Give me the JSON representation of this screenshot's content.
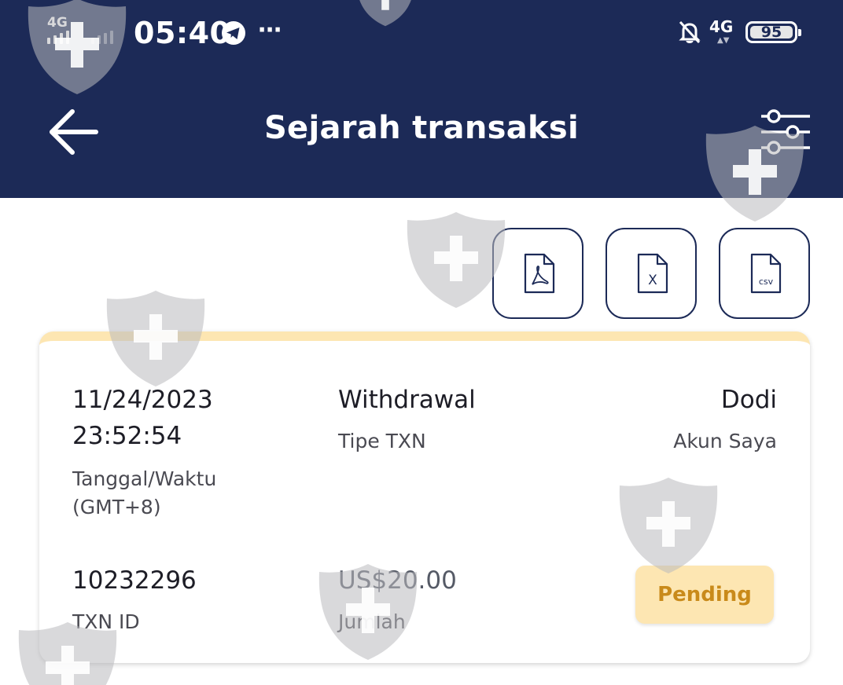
{
  "status_bar": {
    "network_left": "4G",
    "time": "05:40",
    "network_right": "4G",
    "battery_level": "95",
    "icons": [
      "signal-icon",
      "telegram-icon",
      "more-dots-icon",
      "bell-muted-icon",
      "battery-icon"
    ]
  },
  "header": {
    "title": "Sejarah transaksi",
    "back_icon": "arrow-left-icon",
    "filter_icon": "sliders-icon"
  },
  "export": {
    "buttons": [
      {
        "icon": "pdf-icon",
        "glyph": ""
      },
      {
        "icon": "excel-icon",
        "glyph": "X"
      },
      {
        "icon": "csv-icon",
        "glyph": "csv"
      }
    ]
  },
  "transaction": {
    "datetime_line1": "11/24/2023",
    "datetime_line2": "23:52:54",
    "datetime_label_line1": "Tanggal/Waktu",
    "datetime_label_line2": "(GMT+8)",
    "type": "Withdrawal",
    "type_label": "Tipe TXN",
    "account": "Dodi",
    "account_label": "Akun Saya",
    "id": "10232296",
    "id_label": "TXN ID",
    "amount": "US$20.00",
    "amount_label": "Jumlah",
    "status": "Pending"
  },
  "colors": {
    "header_bg": "#1c2a57",
    "card_accent": "#fde6b2",
    "status_text": "#c98a1a"
  }
}
